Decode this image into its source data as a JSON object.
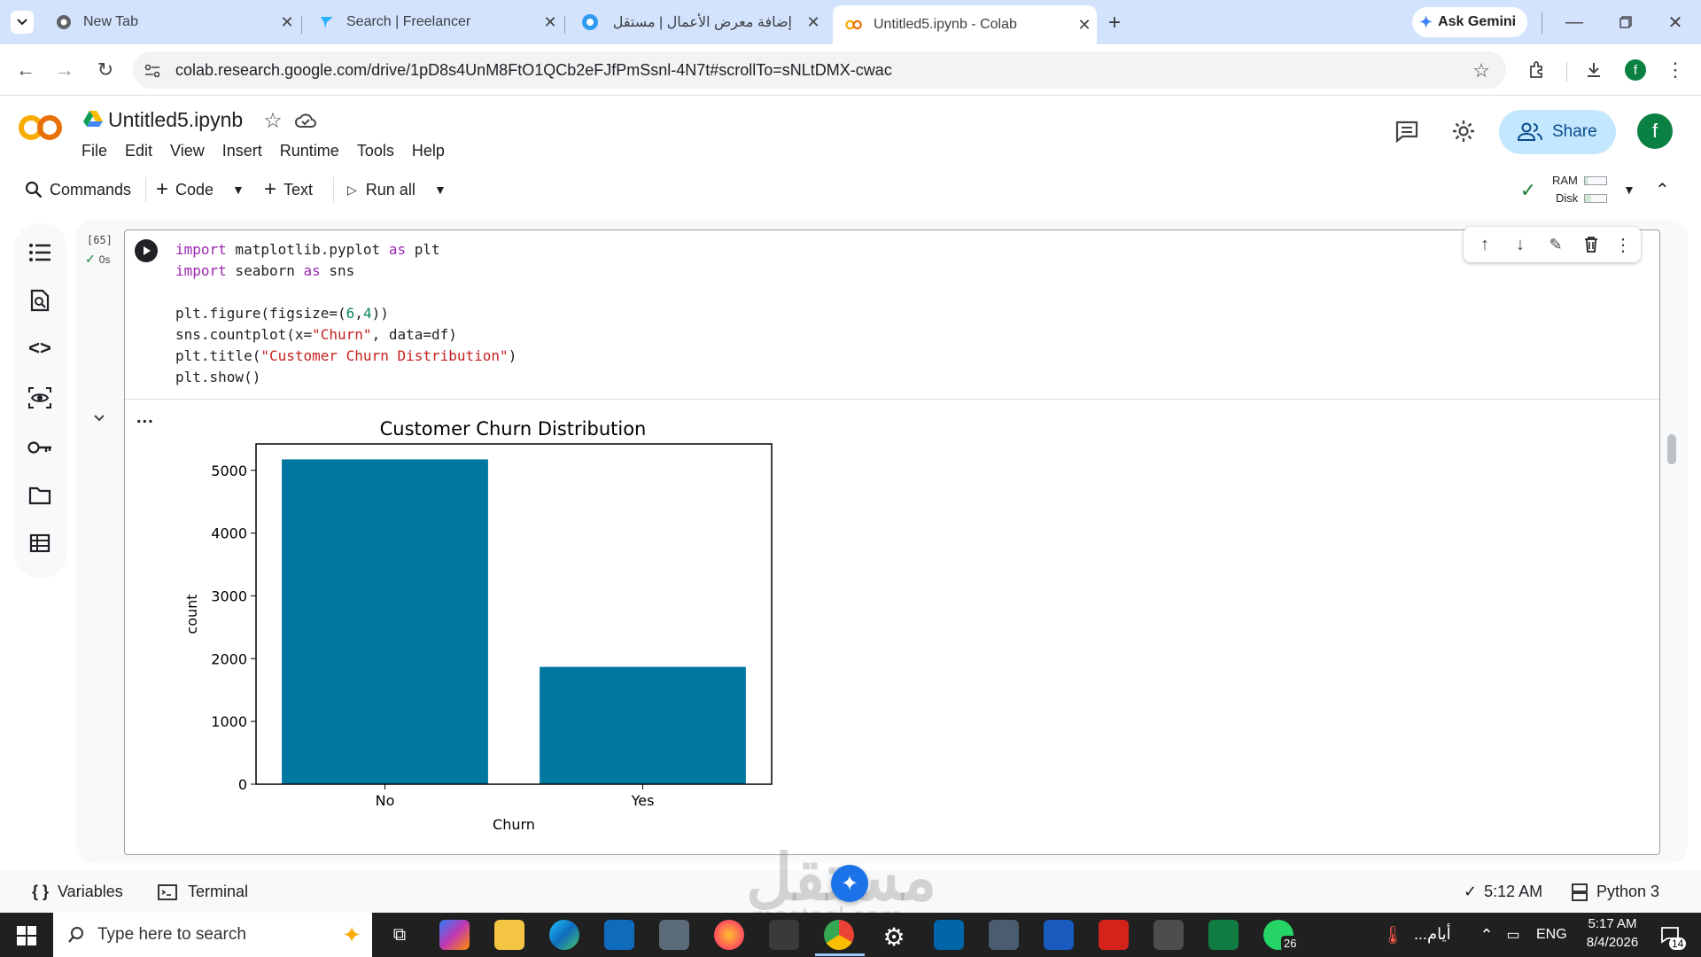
{
  "browser": {
    "tabs": [
      {
        "title": "New Tab"
      },
      {
        "title": "Search | Freelancer"
      },
      {
        "title": "إضافة معرض الأعمال | مستقل"
      },
      {
        "title": "Untitled5.ipynb - Colab"
      }
    ],
    "ask_gemini": "Ask Gemini",
    "url": "colab.research.google.com/drive/1pD8s4UnM8FtO1QCb2eFJfPmSsnl-4N7t#scrollTo=sNLtDMX-cwac",
    "profile_initial": "f"
  },
  "colab": {
    "logo": "CO",
    "notebook_name": "Untitled5.ipynb",
    "menu": [
      "File",
      "Edit",
      "View",
      "Insert",
      "Runtime",
      "Tools",
      "Help"
    ],
    "share_label": "Share",
    "user_initial": "f",
    "toolbar": {
      "commands": "Commands",
      "code": "Code",
      "text": "Text",
      "run_all": "Run all",
      "ram": "RAM",
      "disk": "Disk"
    }
  },
  "cell": {
    "exec_count": "[65]",
    "exec_time": "0s",
    "code_lines": [
      "import matplotlib.pyplot as plt",
      "import seaborn as sns",
      "",
      "plt.figure(figsize=(6,4))",
      "sns.countplot(x=\"Churn\", data=df)",
      "plt.title(\"Customer Churn Distribution\")",
      "plt.show()"
    ],
    "output_menu": "..."
  },
  "chart_data": {
    "type": "bar",
    "title": "Customer Churn Distribution",
    "xlabel": "Churn",
    "ylabel": "count",
    "categories": [
      "No",
      "Yes"
    ],
    "values": [
      5174,
      1869
    ],
    "ylim": [
      0,
      5420
    ],
    "yticks": [
      0,
      1000,
      2000,
      3000,
      4000,
      5000
    ],
    "bar_color": "#0077a1",
    "grid": false
  },
  "footer": {
    "variables": "Variables",
    "terminal": "Terminal",
    "exec_time": "5:12 AM",
    "runtime": "Python 3"
  },
  "watermark": {
    "text": "مستقل",
    "sub": "mostaql.com"
  },
  "taskbar": {
    "search_placeholder": "Type here to search",
    "weather": "أيام...",
    "lang": "ENG",
    "time": "5:17 AM",
    "date": "8/4/2026",
    "whatsapp_badge": "26",
    "notif_badge": "14"
  },
  "colors": {
    "tabstrip": "#d3e3fd",
    "share_bg": "#c2e7ff",
    "accent_orange": "#f9ab00",
    "taskbar": "#202020"
  }
}
